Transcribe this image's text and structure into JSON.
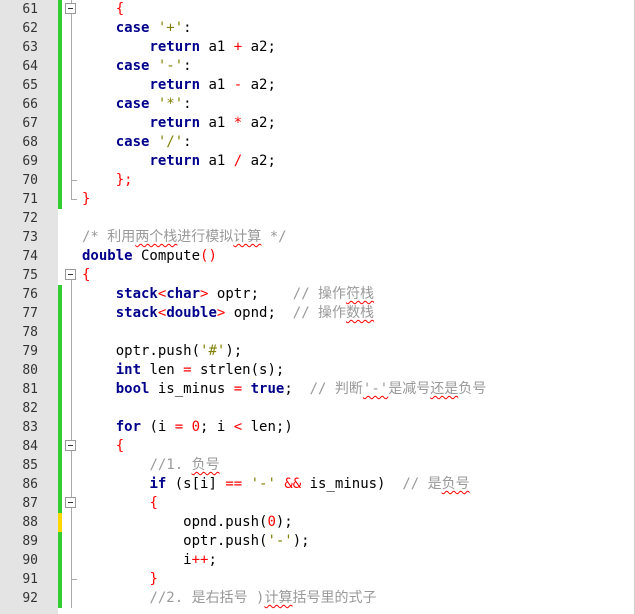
{
  "editor": {
    "colors": {
      "keyword": "#00008b",
      "operator": "#ff0000",
      "string": "#808000",
      "comment": "#999999",
      "saved_marker": "#33cc33",
      "unsaved_marker": "#ffd700"
    },
    "lines": [
      {
        "num": "61",
        "marker": "saved",
        "fold": "mid",
        "tokens": [
          [
            "p",
            "    "
          ],
          [
            "op",
            "{"
          ]
        ]
      },
      {
        "num": "62",
        "marker": "saved",
        "fold": "line",
        "tokens": [
          [
            "p",
            "    "
          ],
          [
            "kw",
            "case"
          ],
          [
            "p",
            " "
          ],
          [
            "str",
            "'+'"
          ],
          [
            "p",
            ":"
          ]
        ]
      },
      {
        "num": "63",
        "marker": "saved",
        "fold": "line",
        "tokens": [
          [
            "p",
            "        "
          ],
          [
            "kw",
            "return"
          ],
          [
            "p",
            " a1 "
          ],
          [
            "op",
            "+"
          ],
          [
            "p",
            " a2;"
          ]
        ]
      },
      {
        "num": "64",
        "marker": "saved",
        "fold": "line",
        "tokens": [
          [
            "p",
            "    "
          ],
          [
            "kw",
            "case"
          ],
          [
            "p",
            " "
          ],
          [
            "str",
            "'-'"
          ],
          [
            "p",
            ":"
          ]
        ]
      },
      {
        "num": "65",
        "marker": "saved",
        "fold": "line",
        "tokens": [
          [
            "p",
            "        "
          ],
          [
            "kw",
            "return"
          ],
          [
            "p",
            " a1 "
          ],
          [
            "op",
            "-"
          ],
          [
            "p",
            " a2;"
          ]
        ]
      },
      {
        "num": "66",
        "marker": "saved",
        "fold": "line",
        "tokens": [
          [
            "p",
            "    "
          ],
          [
            "kw",
            "case"
          ],
          [
            "p",
            " "
          ],
          [
            "str",
            "'*'"
          ],
          [
            "p",
            ":"
          ]
        ]
      },
      {
        "num": "67",
        "marker": "saved",
        "fold": "line",
        "tokens": [
          [
            "p",
            "        "
          ],
          [
            "kw",
            "return"
          ],
          [
            "p",
            " a1 "
          ],
          [
            "op",
            "*"
          ],
          [
            "p",
            " a2;"
          ]
        ]
      },
      {
        "num": "68",
        "marker": "saved",
        "fold": "line",
        "tokens": [
          [
            "p",
            "    "
          ],
          [
            "kw",
            "case"
          ],
          [
            "p",
            " "
          ],
          [
            "str",
            "'/'"
          ],
          [
            "p",
            ":"
          ]
        ]
      },
      {
        "num": "69",
        "marker": "saved",
        "fold": "line",
        "tokens": [
          [
            "p",
            "        "
          ],
          [
            "kw",
            "return"
          ],
          [
            "p",
            " a1 "
          ],
          [
            "op",
            "/"
          ],
          [
            "p",
            " a2;"
          ]
        ]
      },
      {
        "num": "70",
        "marker": "saved",
        "fold": "end",
        "tokens": [
          [
            "p",
            "    "
          ],
          [
            "op",
            "};"
          ]
        ]
      },
      {
        "num": "71",
        "marker": "saved",
        "fold": "end",
        "tokens": [
          [
            "op",
            "}"
          ]
        ]
      },
      {
        "num": "72",
        "marker": "none",
        "fold": "none",
        "tokens": [
          [
            "p",
            ""
          ]
        ]
      },
      {
        "num": "73",
        "marker": "none",
        "fold": "none",
        "tokens": [
          [
            "cm",
            "/* 利用"
          ],
          [
            "cmw",
            "两个栈"
          ],
          [
            "cm",
            "进行模拟"
          ],
          [
            "cmw",
            "计算"
          ],
          [
            "cm",
            " */"
          ]
        ]
      },
      {
        "num": "74",
        "marker": "none",
        "fold": "none",
        "tokens": [
          [
            "kw",
            "double"
          ],
          [
            "p",
            " Compute"
          ],
          [
            "op",
            "()"
          ]
        ]
      },
      {
        "num": "75",
        "marker": "none",
        "fold": "start",
        "tokens": [
          [
            "op",
            "{"
          ]
        ]
      },
      {
        "num": "76",
        "marker": "saved",
        "fold": "line",
        "tokens": [
          [
            "p",
            "    "
          ],
          [
            "kw",
            "stack"
          ],
          [
            "op",
            "<"
          ],
          [
            "kw",
            "char"
          ],
          [
            "op",
            ">"
          ],
          [
            "p",
            " optr;    "
          ],
          [
            "cm",
            "// 操作"
          ],
          [
            "cmw",
            "符栈"
          ]
        ]
      },
      {
        "num": "77",
        "marker": "saved",
        "fold": "line",
        "tokens": [
          [
            "p",
            "    "
          ],
          [
            "kw",
            "stack"
          ],
          [
            "op",
            "<"
          ],
          [
            "kw",
            "double"
          ],
          [
            "op",
            ">"
          ],
          [
            "p",
            " opnd;  "
          ],
          [
            "cm",
            "// 操作"
          ],
          [
            "cmw",
            "数栈"
          ]
        ]
      },
      {
        "num": "78",
        "marker": "saved",
        "fold": "line",
        "tokens": [
          [
            "p",
            ""
          ]
        ]
      },
      {
        "num": "79",
        "marker": "saved",
        "fold": "line",
        "tokens": [
          [
            "p",
            "    optr.push("
          ],
          [
            "str",
            "'#'"
          ],
          [
            "p",
            ");"
          ]
        ]
      },
      {
        "num": "80",
        "marker": "saved",
        "fold": "line",
        "tokens": [
          [
            "p",
            "    "
          ],
          [
            "kw",
            "int"
          ],
          [
            "p",
            " len "
          ],
          [
            "op",
            "="
          ],
          [
            "p",
            " strlen(s);"
          ]
        ]
      },
      {
        "num": "81",
        "marker": "saved",
        "fold": "line",
        "tokens": [
          [
            "p",
            "    "
          ],
          [
            "kw",
            "bool"
          ],
          [
            "p",
            " is_minus "
          ],
          [
            "op",
            "="
          ],
          [
            "p",
            " "
          ],
          [
            "kw",
            "true"
          ],
          [
            "p",
            ";  "
          ],
          [
            "cm",
            "// 判断"
          ],
          [
            "cmw",
            "'-'"
          ],
          [
            "cm",
            "是减号"
          ],
          [
            "cmw",
            "还是"
          ],
          [
            "cm",
            "负号"
          ]
        ]
      },
      {
        "num": "82",
        "marker": "saved",
        "fold": "line",
        "tokens": [
          [
            "p",
            ""
          ]
        ]
      },
      {
        "num": "83",
        "marker": "saved",
        "fold": "line",
        "tokens": [
          [
            "p",
            "    "
          ],
          [
            "kw",
            "for"
          ],
          [
            "p",
            " (i "
          ],
          [
            "op",
            "="
          ],
          [
            "p",
            " "
          ],
          [
            "num",
            "0"
          ],
          [
            "p",
            "; i "
          ],
          [
            "op",
            "<"
          ],
          [
            "p",
            " len;)"
          ]
        ]
      },
      {
        "num": "84",
        "marker": "saved",
        "fold": "mid",
        "tokens": [
          [
            "p",
            "    "
          ],
          [
            "op",
            "{"
          ]
        ]
      },
      {
        "num": "85",
        "marker": "saved",
        "fold": "line",
        "tokens": [
          [
            "p",
            "        "
          ],
          [
            "cm",
            "//1. "
          ],
          [
            "cmw",
            "负号"
          ]
        ]
      },
      {
        "num": "86",
        "marker": "saved",
        "fold": "line",
        "tokens": [
          [
            "p",
            "        "
          ],
          [
            "kw",
            "if"
          ],
          [
            "p",
            " (s[i] "
          ],
          [
            "op",
            "=="
          ],
          [
            "p",
            " "
          ],
          [
            "str",
            "'-'"
          ],
          [
            "p",
            " "
          ],
          [
            "op",
            "&&"
          ],
          [
            "p",
            " is_minus)  "
          ],
          [
            "cm",
            "// 是"
          ],
          [
            "cmw",
            "负号"
          ]
        ]
      },
      {
        "num": "87",
        "marker": "saved",
        "fold": "mid",
        "tokens": [
          [
            "p",
            "        "
          ],
          [
            "op",
            "{"
          ]
        ]
      },
      {
        "num": "88",
        "marker": "unsaved",
        "fold": "line",
        "tokens": [
          [
            "p",
            "            opnd.push("
          ],
          [
            "num",
            "0"
          ],
          [
            "p",
            ");"
          ]
        ]
      },
      {
        "num": "89",
        "marker": "saved",
        "fold": "line",
        "tokens": [
          [
            "p",
            "            optr.push("
          ],
          [
            "str",
            "'-'"
          ],
          [
            "p",
            ");"
          ]
        ]
      },
      {
        "num": "90",
        "marker": "saved",
        "fold": "line",
        "tokens": [
          [
            "p",
            "            i"
          ],
          [
            "op",
            "++"
          ],
          [
            "p",
            ";"
          ]
        ]
      },
      {
        "num": "91",
        "marker": "saved",
        "fold": "end",
        "tokens": [
          [
            "p",
            "        "
          ],
          [
            "op",
            "}"
          ]
        ]
      },
      {
        "num": "92",
        "marker": "saved",
        "fold": "line",
        "tokens": [
          [
            "p",
            "        "
          ],
          [
            "cm",
            "//2. 是右括号 )"
          ],
          [
            "cmw",
            "计算"
          ],
          [
            "cm",
            "括号里的式子"
          ]
        ]
      }
    ]
  }
}
